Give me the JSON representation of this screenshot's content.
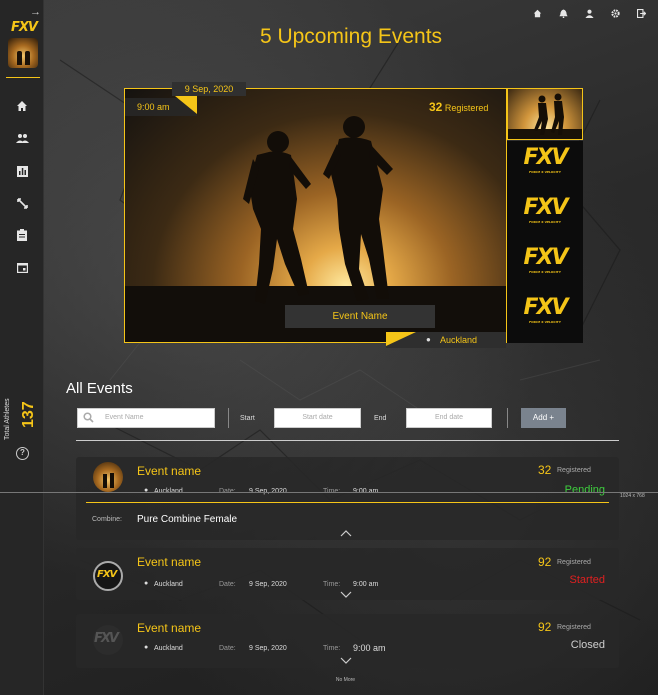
{
  "app": {
    "logo": "FXV"
  },
  "sidebar": {
    "collapse_icon": "arrow-right-icon",
    "items": [
      "home-icon",
      "people-icon",
      "chart-icon",
      "expand-icon",
      "clipboard-icon",
      "calendar-icon"
    ],
    "total_label": "Total Athletes",
    "total_value": "137",
    "help_icon": "help-icon"
  },
  "topbar": {
    "icons": [
      "home-icon",
      "bell-icon",
      "user-icon",
      "gear-icon",
      "logout-icon"
    ]
  },
  "page": {
    "title": "5 Upcoming Events"
  },
  "featured": {
    "date": "9 Sep, 2020",
    "time": "9:00 am",
    "registered_count": "32",
    "registered_label": "Registered",
    "event_name": "Event Name",
    "location": "Auckland"
  },
  "all_events": {
    "title": "All Events",
    "search_placeholder": "Event Name",
    "start_label": "Start",
    "start_placeholder": "Start date",
    "end_label": "End",
    "end_placeholder": "End date",
    "add_label": "Add +"
  },
  "events": [
    {
      "name": "Event name",
      "location": "Auckland",
      "date_label": "Date:",
      "date": "9 Sep, 2020",
      "time_label": "Time:",
      "time": "9:00 am",
      "count": "32",
      "registered_label": "Registered",
      "status": "Pending",
      "status_color": "#3ecf3e",
      "combine_label": "Combine:",
      "combine_value": "Pure Combine Female"
    },
    {
      "name": "Event name",
      "location": "Auckland",
      "date_label": "Date:",
      "date": "9 Sep, 2020",
      "time_label": "Time:",
      "time": "9:00 am",
      "count": "92",
      "registered_label": "Registered",
      "status": "Started",
      "status_color": "#e02020"
    },
    {
      "name": "Event name",
      "location": "Auckland",
      "date_label": "Date:",
      "date": "9 Sep, 2020",
      "time_label": "Time:",
      "time": "9:00 am",
      "count": "92",
      "registered_label": "Registered",
      "status": "Closed",
      "status_color": "#cfcfcf"
    }
  ],
  "footer": {
    "no_more": "No More",
    "resolution": "1024 x 768"
  },
  "colors": {
    "accent": "#f5c518",
    "bg": "#2a2a2a"
  }
}
